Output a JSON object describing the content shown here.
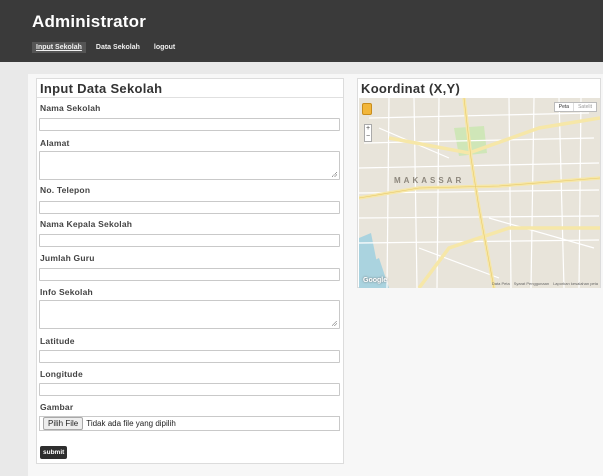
{
  "header": {
    "title": "Administrator",
    "nav": [
      {
        "label": "Input Sekolah",
        "active": true
      },
      {
        "label": "Data Sekolah",
        "active": false
      },
      {
        "label": "logout",
        "active": false
      }
    ]
  },
  "form": {
    "title": "Input Data Sekolah",
    "fields": {
      "nama_sekolah": "Nama Sekolah",
      "alamat": "Alamat",
      "no_telepon": "No. Telepon",
      "nama_kepala": "Nama Kepala Sekolah",
      "jumlah_guru": "Jumlah Guru",
      "info_sekolah": "Info Sekolah",
      "latitude": "Latitude",
      "longitude": "Longitude",
      "gambar": "Gambar"
    },
    "file_button": "Pilih File",
    "file_status": "Tidak ada file yang dipilih",
    "submit": "submit"
  },
  "map": {
    "title": "Koordinat (X,Y)",
    "city_label": "MAKASSAR",
    "type_buttons": [
      "Peta",
      "Satelit"
    ],
    "zoom": [
      "+",
      "−"
    ],
    "brand": "Google",
    "footer": [
      "Data Peta",
      "Syarat Penggunaan",
      "Laporkan kesalahan peta"
    ],
    "colors": {
      "land": "#e8e4da",
      "road": "#ffffff",
      "major_road": "#f6e7a8",
      "water": "#aad3df",
      "park": "#cfe6b8"
    }
  }
}
